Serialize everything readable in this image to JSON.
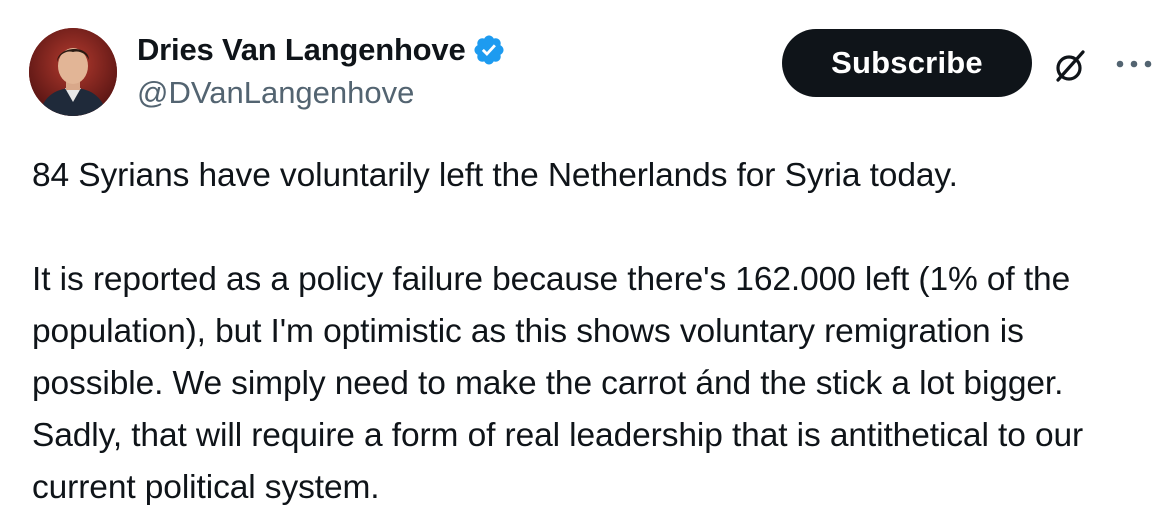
{
  "author": {
    "display_name": "Dries Van Langenhove",
    "handle": "@DVanLangenhove",
    "verified": true,
    "verified_color": "#1d9bf0",
    "avatar": "profile-photo"
  },
  "actions": {
    "subscribe_label": "Subscribe",
    "grok_icon": "grok-icon",
    "more_icon": "more-options-icon"
  },
  "tweet": {
    "text": "84 Syrians have voluntarily left the Netherlands for Syria today.\n\nIt is reported as a policy failure because there's 162.000 left (1% of the population), but I'm optimistic as this shows voluntary remigration is possible. We simply need to make the carrot ánd the stick a lot bigger. Sadly, that will require a form of real leadership that is antithetical to our current political system."
  },
  "colors": {
    "text_primary": "#0f1419",
    "text_secondary": "#536471",
    "button_bg": "#0f1419",
    "button_text": "#ffffff"
  }
}
